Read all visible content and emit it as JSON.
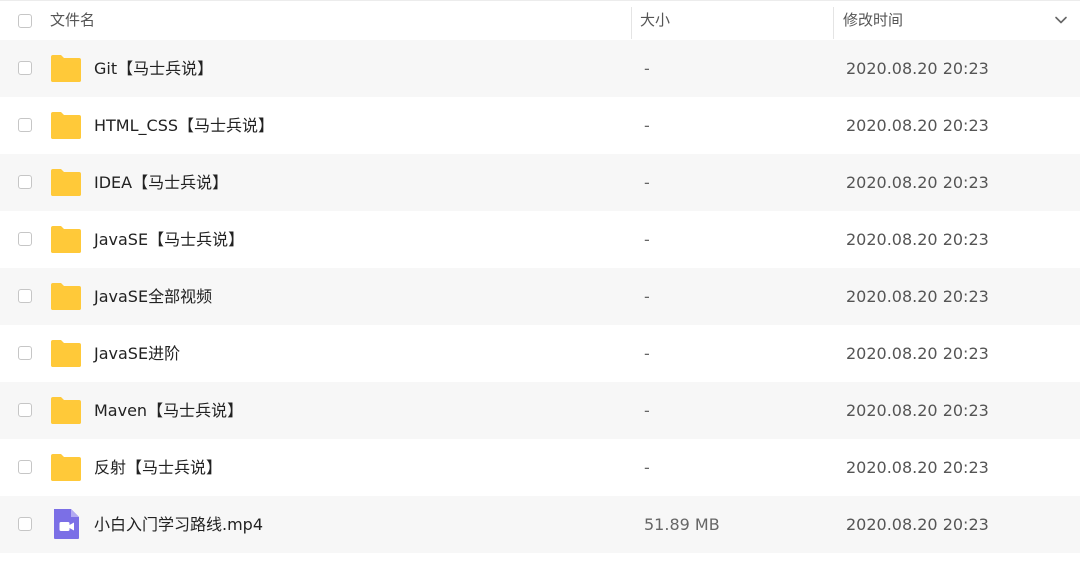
{
  "header": {
    "name_label": "文件名",
    "size_label": "大小",
    "date_label": "修改时间"
  },
  "colors": {
    "folder": "#FFC93A",
    "video_file": "#7B6FE6",
    "row_alt": "#F7F7F7"
  },
  "files": [
    {
      "name": "Git【马士兵说】",
      "size": "-",
      "date": "2020.08.20 20:23",
      "icon": "folder-icon"
    },
    {
      "name": "HTML_CSS【马士兵说】",
      "size": "-",
      "date": "2020.08.20 20:23",
      "icon": "folder-icon"
    },
    {
      "name": "IDEA【马士兵说】",
      "size": "-",
      "date": "2020.08.20 20:23",
      "icon": "folder-icon"
    },
    {
      "name": "JavaSE【马士兵说】",
      "size": "-",
      "date": "2020.08.20 20:23",
      "icon": "folder-icon"
    },
    {
      "name": "JavaSE全部视频",
      "size": "-",
      "date": "2020.08.20 20:23",
      "icon": "folder-icon"
    },
    {
      "name": "JavaSE进阶",
      "size": "-",
      "date": "2020.08.20 20:23",
      "icon": "folder-icon"
    },
    {
      "name": "Maven【马士兵说】",
      "size": "-",
      "date": "2020.08.20 20:23",
      "icon": "folder-icon"
    },
    {
      "name": "反射【马士兵说】",
      "size": "-",
      "date": "2020.08.20 20:23",
      "icon": "folder-icon"
    },
    {
      "name": "小白入门学习路线.mp4",
      "size": "51.89 MB",
      "date": "2020.08.20 20:23",
      "icon": "video-file-icon"
    }
  ]
}
